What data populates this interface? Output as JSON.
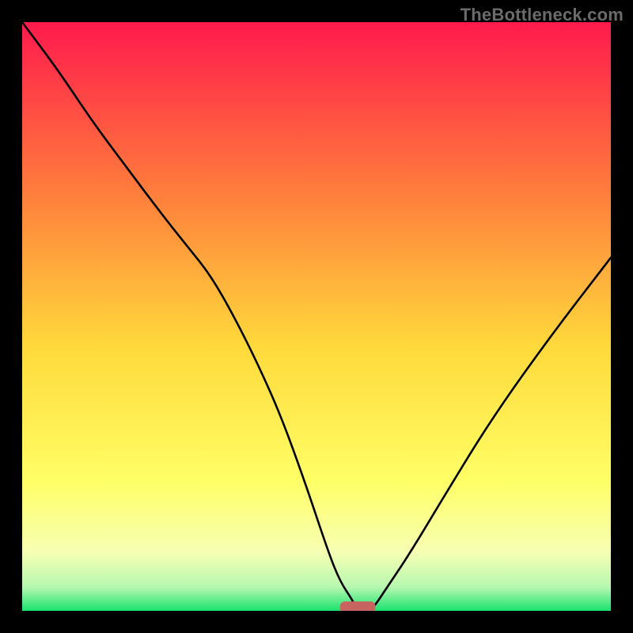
{
  "watermark": "TheBottleneck.com",
  "colors": {
    "frame": "#000000",
    "grad_top": "#ff1a4d",
    "grad_mid1": "#ff7a3c",
    "grad_mid2": "#ffd93b",
    "grad_mid3": "#ffff66",
    "grad_low1": "#f6ffb3",
    "grad_low2": "#b6f7b0",
    "grad_bottom": "#19e36c",
    "curve": "#000000",
    "marker": "#c8645f"
  },
  "chart_data": {
    "type": "line",
    "title": "",
    "xlabel": "",
    "ylabel": "",
    "xlim": [
      0,
      100
    ],
    "ylim": [
      0,
      100
    ],
    "grid": false,
    "legend": false,
    "series": [
      {
        "name": "bottleneck-curve",
        "x": [
          0,
          6,
          12,
          18,
          24,
          28,
          32,
          36,
          40,
          44,
          48,
          52,
          54,
          56,
          57,
          58,
          59,
          60,
          62,
          66,
          72,
          80,
          90,
          100
        ],
        "y": [
          100,
          92,
          83,
          75,
          67,
          62,
          57,
          50,
          42,
          33,
          22,
          10,
          5,
          2,
          0,
          0,
          0,
          1,
          4,
          10,
          20,
          33,
          47,
          60
        ]
      }
    ],
    "marker": {
      "x": 57,
      "y": 0,
      "w": 6,
      "h": 2
    }
  }
}
